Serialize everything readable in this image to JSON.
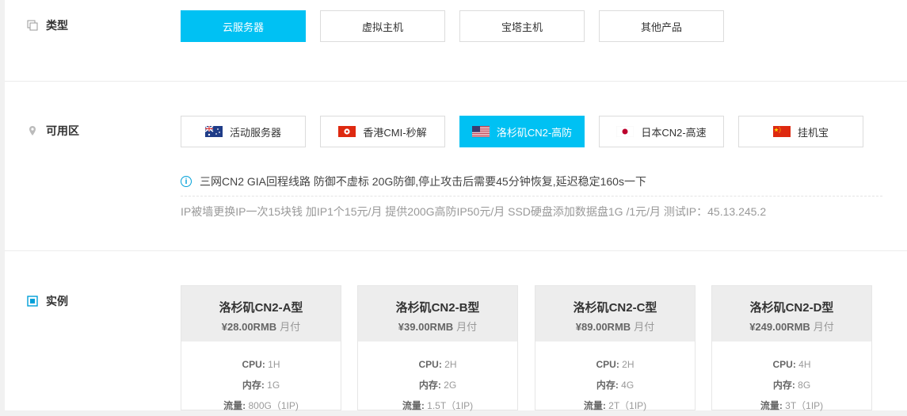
{
  "type_section": {
    "label": "类型",
    "options": [
      {
        "label": "云服务器",
        "active": true
      },
      {
        "label": "虚拟主机",
        "active": false
      },
      {
        "label": "宝塔主机",
        "active": false
      },
      {
        "label": "其他产品",
        "active": false
      }
    ]
  },
  "zone_section": {
    "label": "可用区",
    "options": [
      {
        "label": "活动服务器",
        "flag": "australia-flag-icon",
        "active": false
      },
      {
        "label": "香港CMI-秒解",
        "flag": "hongkong-flag-icon",
        "active": false
      },
      {
        "label": "洛杉矶CN2-高防",
        "flag": "usa-flag-icon",
        "active": true
      },
      {
        "label": "日本CN2-高速",
        "flag": "japan-flag-icon",
        "active": false
      },
      {
        "label": "挂机宝",
        "flag": "china-flag-icon",
        "active": false
      }
    ],
    "info": "三网CN2 GIA回程线路 防御不虚标 20G防御,停止攻击后需要45分钟恢复,延迟稳定160s一下",
    "note": "IP被墙更换IP一次15块钱 加IP1个15元/月 提供200G高防IP50元/月 SSD硬盘添加数据盘1G /1元/月 测试IP：45.13.245.2"
  },
  "instance_section": {
    "label": "实例",
    "spec_labels": {
      "cpu": "CPU:",
      "mem": "内存:",
      "traffic": "流量:"
    },
    "plans": [
      {
        "name": "洛杉矶CN2-A型",
        "price": "¥28.00RMB",
        "cycle": "月付",
        "cpu": "1H",
        "mem": "1G",
        "traffic": "800G（1IP)"
      },
      {
        "name": "洛杉矶CN2-B型",
        "price": "¥39.00RMB",
        "cycle": "月付",
        "cpu": "2H",
        "mem": "2G",
        "traffic": "1.5T（1IP)"
      },
      {
        "name": "洛杉矶CN2-C型",
        "price": "¥89.00RMB",
        "cycle": "月付",
        "cpu": "2H",
        "mem": "4G",
        "traffic": "2T（1IP)"
      },
      {
        "name": "洛杉矶CN2-D型",
        "price": "¥249.00RMB",
        "cycle": "月付",
        "cpu": "4H",
        "mem": "8G",
        "traffic": "3T（1IP)"
      }
    ]
  },
  "colors": {
    "accent": "#00c1f3"
  }
}
